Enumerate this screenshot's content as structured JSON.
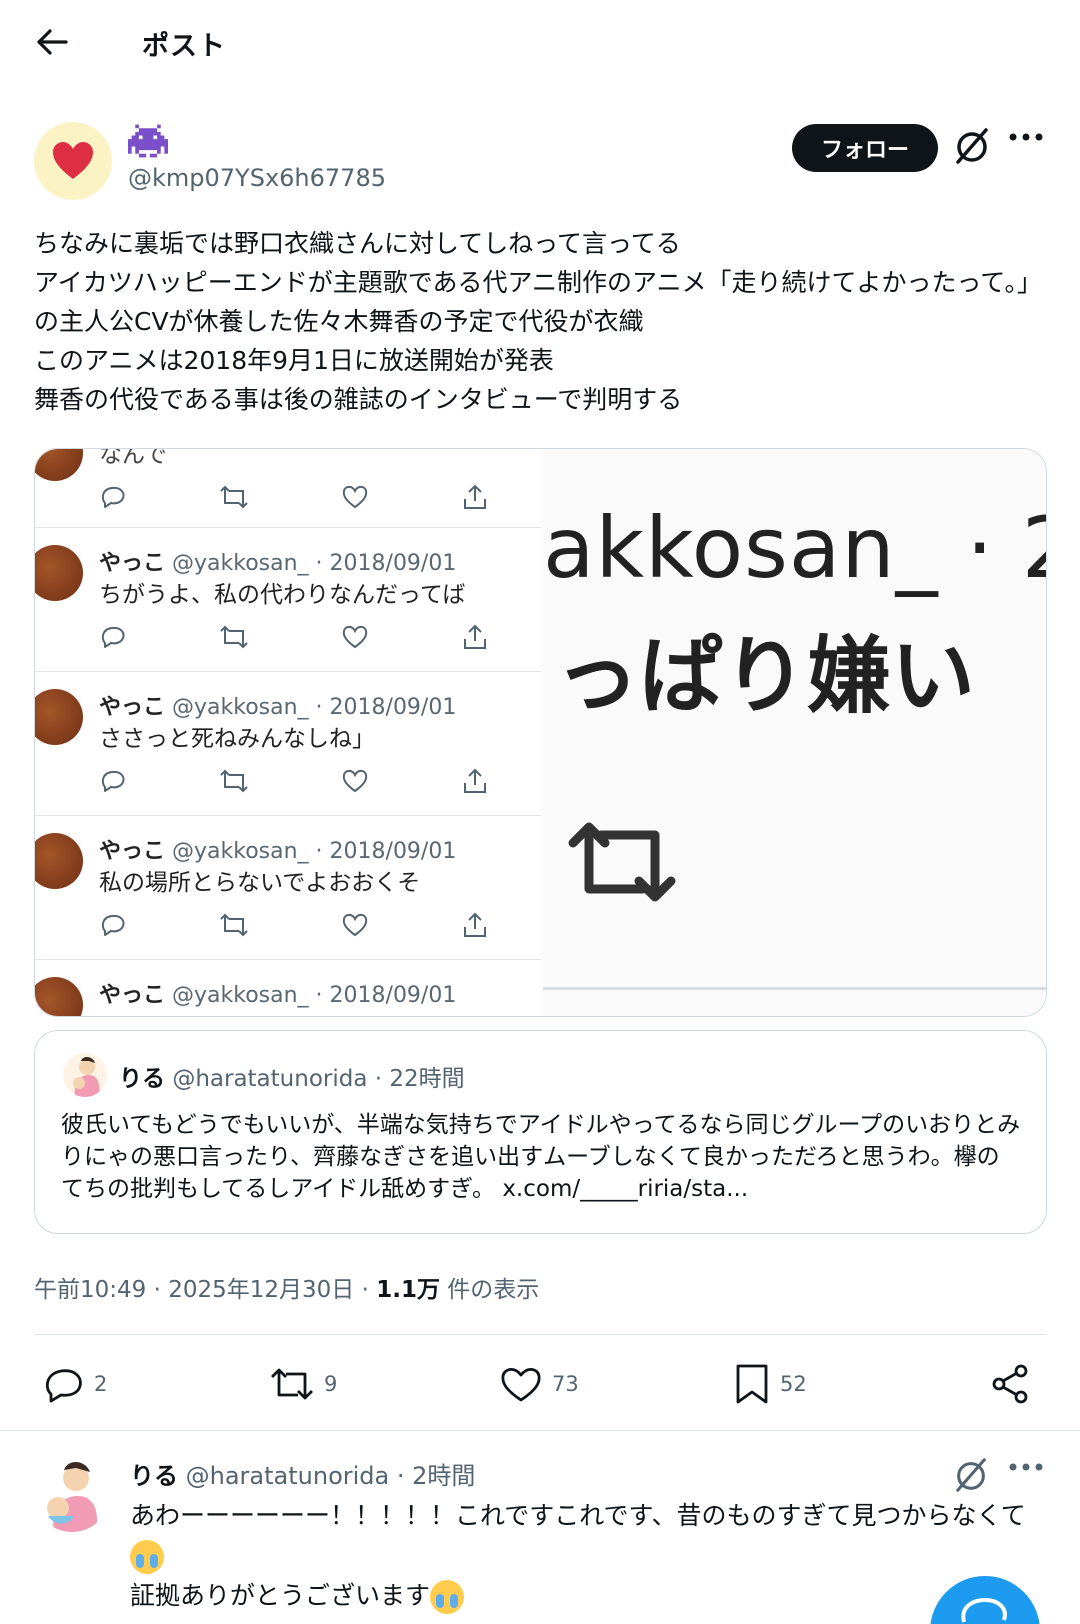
{
  "header": {
    "title": "ポスト"
  },
  "author": {
    "handle": "@kmp07YSx6h67785"
  },
  "follow_label": "フォロー",
  "post_text": "ちなみに裏垢では野口衣織さんに対してしねって言ってる\nアイカツハッピーエンドが主題歌である代アニ制作のアニメ「走り続けてよかったって。」の主人公CVが休養した佐々木舞香の予定で代役が衣織\nこのアニメは2018年9月1日に放送開始が発表\n舞香の代役である事は後の雑誌のインタビューで判明する",
  "media": {
    "top_partial": "なんで",
    "tweets": [
      {
        "name": "やっこ",
        "meta": "@yakkosan_ · 2018/09/01",
        "text": "ちがうよ、私の代わりなんだってば"
      },
      {
        "name": "やっこ",
        "meta": "@yakkosan_ · 2018/09/01",
        "text": "ささっと死ねみんなしね」"
      },
      {
        "name": "やっこ",
        "meta": "@yakkosan_ · 2018/09/01",
        "text": "私の場所とらないでよおおくそ"
      },
      {
        "name": "やっこ",
        "meta": "@yakkosan_ · 2018/09/01",
        "text": ""
      }
    ],
    "zoom_line1": "akkosan_ · 2",
    "zoom_line2": "っぱり嫌い"
  },
  "quote": {
    "name": "りる",
    "handle": "@haratatunorida",
    "time": "· 22時間",
    "text": "彼氏いてもどうでもいいが、半端な気持ちでアイドルやってるなら同じグループのいおりとみりにゃの悪口言ったり、齊藤なぎさを追い出すムーブしなくて良かっただろと思うわ。欅のてちの批判もしてるしアイドル舐めすぎ。 x.com/_____riria/sta..."
  },
  "meta": {
    "time": "午前10:49 · 2025年12月30日 ·",
    "views": "1.1万",
    "views_suffix": "件の表示"
  },
  "actions": {
    "replies": "2",
    "reposts": "9",
    "likes": "73",
    "bookmarks": "52"
  },
  "reply": {
    "name": "りる",
    "handle": "@haratatunorida",
    "time": "· 2時間",
    "text_line1": "あわーーーーーー！！！！！これですこれです、昔のものすぎて見つからなくて",
    "text_line2": "証拠ありがとうございます"
  },
  "colors": {
    "accent": "#1d9bf0",
    "text": "#0f1419",
    "secondary": "#536471"
  }
}
